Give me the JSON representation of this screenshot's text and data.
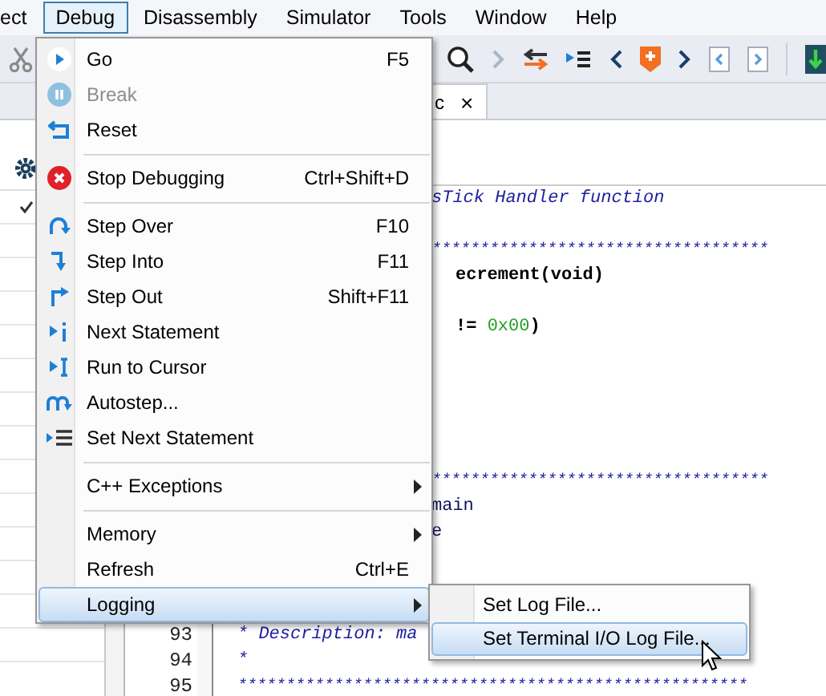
{
  "menubar": [
    {
      "label": "ect",
      "selected": false
    },
    {
      "label": "Debug",
      "selected": true
    },
    {
      "label": "Disassembly",
      "selected": false
    },
    {
      "label": "Simulator",
      "selected": false
    },
    {
      "label": "Tools",
      "selected": false
    },
    {
      "label": "Window",
      "selected": false
    },
    {
      "label": "Help",
      "selected": false
    }
  ],
  "editor": {
    "tab": {
      "label": "c",
      "close": "×"
    },
    "lines": [
      {
        "kind": "comment",
        "partial": true,
        "text": "sTick Handler function"
      },
      {
        "kind": "blank"
      },
      {
        "kind": "stars",
        "partial": true,
        "text": "***********************************"
      },
      {
        "kind": "code",
        "partial": true,
        "text": "ecrement(void)"
      },
      {
        "kind": "blank"
      },
      {
        "kind": "code",
        "partial": true,
        "text": "!= ",
        "number": "0x00",
        "after": ")"
      },
      {
        "kind": "blank"
      },
      {
        "kind": "blank"
      },
      {
        "kind": "blank"
      },
      {
        "kind": "blank"
      },
      {
        "kind": "blank"
      },
      {
        "kind": "stars",
        "partial": true,
        "text": "***********************************"
      },
      {
        "kind": "plain",
        "partial": true,
        "text": "main"
      },
      {
        "kind": "plain",
        "partial": true,
        "text": "e"
      },
      {
        "kind": "blank"
      },
      {
        "kind": "blank"
      },
      {
        "kind": "blank"
      },
      {
        "kind": "comment",
        "partial": false,
        "line_number": "93",
        "text": "* Description: ma"
      },
      {
        "kind": "comment",
        "partial": false,
        "line_number": "94",
        "text": "*"
      },
      {
        "kind": "stars",
        "partial": false,
        "line_number": "95",
        "text": "*****************************************************"
      }
    ]
  },
  "debug_menu": {
    "items": [
      {
        "kind": "item",
        "label": "Go",
        "shortcut": "F5",
        "disabled": false,
        "selected": false
      },
      {
        "kind": "item",
        "label": "Break",
        "disabled": true,
        "selected": false
      },
      {
        "kind": "item",
        "label": "Reset",
        "disabled": false,
        "selected": false
      },
      {
        "kind": "separator"
      },
      {
        "kind": "item",
        "label": "Stop Debugging",
        "shortcut": "Ctrl+Shift+D",
        "disabled": false,
        "selected": false
      },
      {
        "kind": "separator"
      },
      {
        "kind": "item",
        "label": "Step Over",
        "shortcut": "F10",
        "disabled": false,
        "selected": false
      },
      {
        "kind": "item",
        "label": "Step Into",
        "shortcut": "F11",
        "disabled": false,
        "selected": false
      },
      {
        "kind": "item",
        "label": "Step Out",
        "shortcut": "Shift+F11",
        "disabled": false,
        "selected": false
      },
      {
        "kind": "item",
        "label": "Next Statement",
        "disabled": false,
        "selected": false
      },
      {
        "kind": "item",
        "label": "Run to Cursor",
        "disabled": false,
        "selected": false
      },
      {
        "kind": "item",
        "label": "Autostep...",
        "disabled": false,
        "selected": false
      },
      {
        "kind": "item",
        "label": "Set Next Statement",
        "disabled": false,
        "selected": false
      },
      {
        "kind": "separator"
      },
      {
        "kind": "submenu",
        "label": "C++ Exceptions",
        "disabled": false,
        "selected": false
      },
      {
        "kind": "separator"
      },
      {
        "kind": "submenu",
        "label": "Memory",
        "disabled": false,
        "selected": false
      },
      {
        "kind": "item",
        "label": "Refresh",
        "shortcut": "Ctrl+E",
        "disabled": false,
        "selected": false
      },
      {
        "kind": "submenu",
        "label": "Logging",
        "disabled": false,
        "selected": true
      }
    ]
  },
  "logging_submenu": {
    "items": [
      {
        "label": "Set Log File...",
        "selected": false
      },
      {
        "label": "Set Terminal I/O Log File...",
        "selected": true
      }
    ]
  }
}
